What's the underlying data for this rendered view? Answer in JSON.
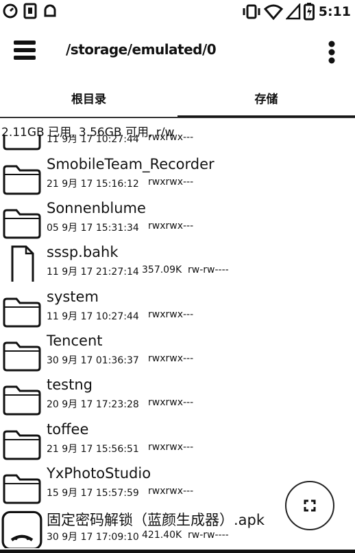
{
  "status_bar": {
    "time": "5:11",
    "icons_left": [
      "gauge-icon",
      "sim-card-icon",
      "android-icon"
    ],
    "icons_right": [
      "vibrate-icon",
      "wifi-icon",
      "signal-icon",
      "battery-icon"
    ]
  },
  "app_bar": {
    "path": "/storage/emulated/0",
    "menu_icon": "hamburger-icon",
    "more_icon": "overflow-icon"
  },
  "tabs": [
    {
      "label": "根目录",
      "selected": false
    },
    {
      "label": "存储",
      "selected": true
    }
  ],
  "storage_info": "2.11GB 已用, 3.56GB 可用, r/w",
  "files": [
    {
      "type": "folder",
      "name": "",
      "date": "11 9月 17 10:27:44",
      "size": "",
      "perm": "rwxrwx---"
    },
    {
      "type": "folder",
      "name": "SmobileTeam_Recorder",
      "date": "21 9月 17 15:16:12",
      "size": "",
      "perm": "rwxrwx---"
    },
    {
      "type": "folder",
      "name": "Sonnenblume",
      "date": "05 9月 17 15:31:34",
      "size": "",
      "perm": "rwxrwx---"
    },
    {
      "type": "file",
      "name": "sssp.bahk",
      "date": "11 9月 17 21:27:14",
      "size": "357.09K",
      "perm": "rw-rw----"
    },
    {
      "type": "folder",
      "name": "system",
      "date": "11 9月 17 10:27:44",
      "size": "",
      "perm": "rwxrwx---"
    },
    {
      "type": "folder",
      "name": "Tencent",
      "date": "30 9月 17 01:36:37",
      "size": "",
      "perm": "rwxrwx---"
    },
    {
      "type": "folder",
      "name": "testng",
      "date": "20 9月 17 17:23:28",
      "size": "",
      "perm": "rwxrwx---"
    },
    {
      "type": "folder",
      "name": "toffee",
      "date": "21 9月 17 15:56:51",
      "size": "",
      "perm": "rwxrwx---"
    },
    {
      "type": "folder",
      "name": "YxPhotoStudio",
      "date": "15 9月 17 15:57:59",
      "size": "",
      "perm": "rwxrwx---"
    },
    {
      "type": "apk",
      "name": "固定密码解锁（蓝颜生成器）.apk",
      "date": "30 9月 17 17:09:10",
      "size": "421.40K",
      "perm": "rw-rw----"
    }
  ],
  "fab": {
    "icon": "jump-icon"
  }
}
